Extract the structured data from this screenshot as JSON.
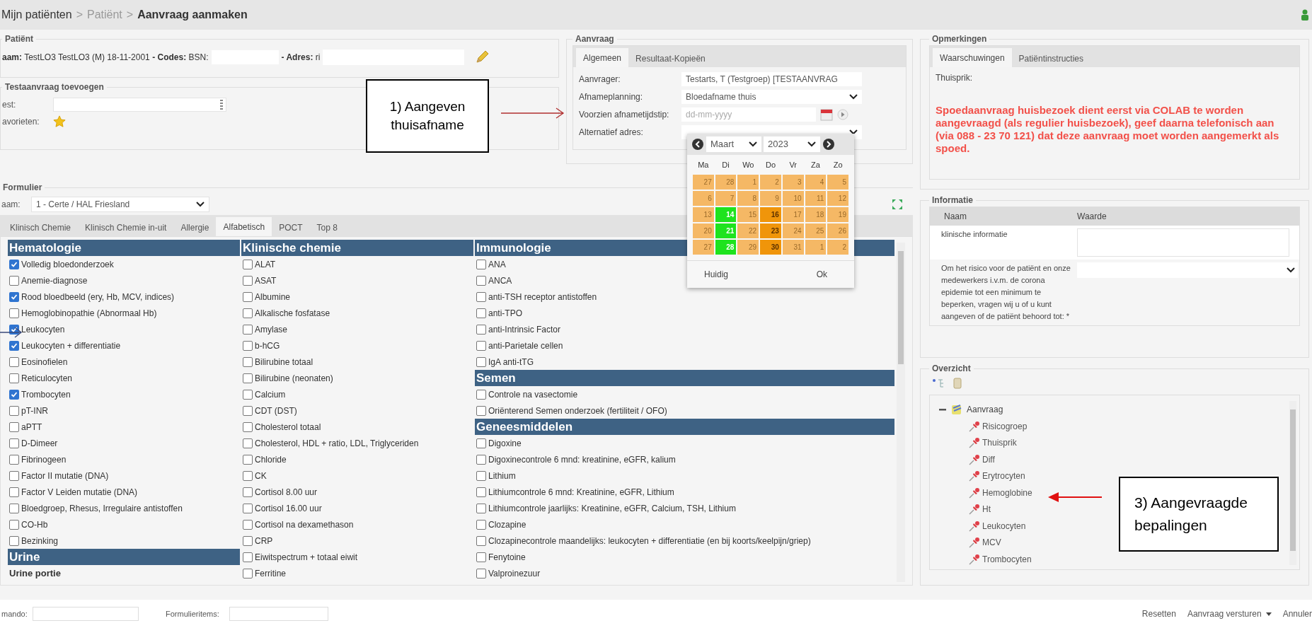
{
  "breadcrumb": {
    "separator": ">",
    "items": [
      {
        "label": "Mijn patiënten",
        "kind": "link"
      },
      {
        "label": "Patiënt",
        "kind": "disabled"
      },
      {
        "label": "Aanvraag aanmaken",
        "kind": "current"
      }
    ]
  },
  "patient": {
    "legend": "Patiënt",
    "name_label": "aam:",
    "name": "TestLO3 TestLO3 (M) 18-11-2001",
    "codes_label": "- Codes:",
    "bsn_label": "BSN:",
    "address_label": "- Adres:",
    "address": "ri"
  },
  "test_request": {
    "legend": "Testaanvraag toevoegen",
    "test_label": "est:",
    "favorites_label": "avorieten:"
  },
  "request": {
    "legend": "Aanvraag",
    "tabs": [
      {
        "label": "Algemeen",
        "selected": true
      },
      {
        "label": "Resultaat-Kopieën",
        "selected": false
      }
    ],
    "requester_label": "Aanvrager:",
    "requester": "Testarts, T (Testgroep) [TESTAANVRAG",
    "planning_label": "Afnameplanning:",
    "planning": "Bloedafname thuis",
    "time_label": "Voorzien afnametijdstip:",
    "time_placeholder": "dd-mm-yyyy",
    "address_label": "Alternatief adres:"
  },
  "calendar": {
    "month": "Maart",
    "year": "2023",
    "weekdays": [
      "Ma",
      "Di",
      "Wo",
      "Do",
      "Vr",
      "Za",
      "Zo"
    ],
    "days": [
      {
        "day": "27",
        "kind": "default"
      },
      {
        "day": "28",
        "kind": "default"
      },
      {
        "day": "1",
        "kind": "default"
      },
      {
        "day": "2",
        "kind": "default"
      },
      {
        "day": "3",
        "kind": "default"
      },
      {
        "day": "4",
        "kind": "default"
      },
      {
        "day": "5",
        "kind": "default"
      },
      {
        "day": "6",
        "kind": "default"
      },
      {
        "day": "7",
        "kind": "default"
      },
      {
        "day": "8",
        "kind": "default"
      },
      {
        "day": "9",
        "kind": "default"
      },
      {
        "day": "10",
        "kind": "default"
      },
      {
        "day": "11",
        "kind": "default"
      },
      {
        "day": "12",
        "kind": "default"
      },
      {
        "day": "13",
        "kind": "default"
      },
      {
        "day": "14",
        "kind": "available"
      },
      {
        "day": "15",
        "kind": "default"
      },
      {
        "day": "16",
        "kind": "planned"
      },
      {
        "day": "17",
        "kind": "default"
      },
      {
        "day": "18",
        "kind": "default"
      },
      {
        "day": "19",
        "kind": "default"
      },
      {
        "day": "20",
        "kind": "default"
      },
      {
        "day": "21",
        "kind": "available"
      },
      {
        "day": "22",
        "kind": "default"
      },
      {
        "day": "23",
        "kind": "planned"
      },
      {
        "day": "24",
        "kind": "default"
      },
      {
        "day": "25",
        "kind": "default"
      },
      {
        "day": "26",
        "kind": "default"
      },
      {
        "day": "27",
        "kind": "default"
      },
      {
        "day": "28",
        "kind": "available"
      },
      {
        "day": "29",
        "kind": "default"
      },
      {
        "day": "30",
        "kind": "planned"
      },
      {
        "day": "31",
        "kind": "default"
      },
      {
        "day": "1",
        "kind": "default"
      },
      {
        "day": "2",
        "kind": "default"
      }
    ],
    "today_button": "Huidig",
    "ok_button": "Ok"
  },
  "form": {
    "legend": "Formulier",
    "name_label": "aam:",
    "name": "1 - Certe / HAL Friesland",
    "tabs": [
      {
        "label": "Klinisch Chemie",
        "selected": false
      },
      {
        "label": "Klinisch Chemie in-uit",
        "selected": false
      },
      {
        "label": "Allergie",
        "selected": false
      },
      {
        "label": "Alfabetisch",
        "selected": true
      },
      {
        "label": "POCT",
        "selected": false
      },
      {
        "label": "Top 8",
        "selected": false
      }
    ],
    "columns": [
      {
        "sections": [
          {
            "title": "Hematologie",
            "items": [
              {
                "label": "Volledig bloedonderzoek",
                "checked": true
              },
              {
                "label": "Anemie-diagnose",
                "checked": false
              },
              {
                "label": "Rood bloedbeeld (ery, Hb, MCV, indices)",
                "checked": true
              },
              {
                "label": "Hemoglobinopathie (Abnormaal Hb)",
                "checked": false
              },
              {
                "label": "Leukocyten",
                "checked": true
              },
              {
                "label": "Leukocyten + differentiatie",
                "checked": true
              },
              {
                "label": "Eosinofielen",
                "checked": false
              },
              {
                "label": "Reticulocyten",
                "checked": false
              },
              {
                "label": "Trombocyten",
                "checked": true
              },
              {
                "label": "pT-INR",
                "checked": false
              },
              {
                "label": "aPTT",
                "checked": false
              },
              {
                "label": "D-Dimeer",
                "checked": false
              },
              {
                "label": "Fibrinogeen",
                "checked": false
              },
              {
                "label": "Factor II mutatie (DNA)",
                "checked": false
              },
              {
                "label": "Factor V Leiden mutatie (DNA)",
                "checked": false
              },
              {
                "label": "Bloedgroep, Rhesus, Irregulaire antistoffen",
                "checked": false
              },
              {
                "label": "CO-Hb",
                "checked": false
              },
              {
                "label": "Bezinking",
                "checked": false
              }
            ]
          },
          {
            "title": "Urine",
            "subtitle": "Urine portie"
          }
        ]
      },
      {
        "sections": [
          {
            "title": "Klinische chemie",
            "items": [
              {
                "label": "ALAT",
                "checked": false
              },
              {
                "label": "ASAT",
                "checked": false
              },
              {
                "label": "Albumine",
                "checked": false
              },
              {
                "label": "Alkalische fosfatase",
                "checked": false
              },
              {
                "label": "Amylase",
                "checked": false
              },
              {
                "label": "b-hCG",
                "checked": false
              },
              {
                "label": "Bilirubine totaal",
                "checked": false
              },
              {
                "label": "Bilirubine (neonaten)",
                "checked": false
              },
              {
                "label": "Calcium",
                "checked": false
              },
              {
                "label": "CDT (DST)",
                "checked": false
              },
              {
                "label": "Cholesterol totaal",
                "checked": false
              },
              {
                "label": "Cholesterol, HDL + ratio, LDL, Triglyceriden",
                "checked": false
              },
              {
                "label": "Chloride",
                "checked": false
              },
              {
                "label": "CK",
                "checked": false
              },
              {
                "label": "Cortisol 8.00 uur",
                "checked": false
              },
              {
                "label": "Cortisol 16.00 uur",
                "checked": false
              },
              {
                "label": "Cortisol na dexamethason",
                "checked": false
              },
              {
                "label": "CRP",
                "checked": false
              },
              {
                "label": "Eiwitspectrum + totaal eiwit",
                "checked": false
              },
              {
                "label": "Ferritine",
                "checked": false
              }
            ]
          }
        ]
      },
      {
        "sections": [
          {
            "title": "Immunologie",
            "items": [
              {
                "label": "ANA",
                "checked": false
              },
              {
                "label": "ANCA",
                "checked": false
              },
              {
                "label": "anti-TSH receptor antistoffen",
                "checked": false
              },
              {
                "label": "anti-TPO",
                "checked": false
              },
              {
                "label": "anti-Intrinsic Factor",
                "checked": false
              },
              {
                "label": "anti-Parietale cellen",
                "checked": false
              },
              {
                "label": "IgA anti-tTG",
                "checked": false
              }
            ]
          },
          {
            "title": "Semen",
            "items": [
              {
                "label": "Controle na vasectomie",
                "checked": false
              },
              {
                "label": "Oriënterend Semen onderzoek (fertiliteit / OFO)",
                "checked": false
              }
            ]
          },
          {
            "title": "Geneesmiddelen",
            "items": [
              {
                "label": "Digoxine",
                "checked": false
              },
              {
                "label": "Digoxinecontrole 6 mnd: kreatinine, eGFR, kalium",
                "checked": false
              },
              {
                "label": "Lithium",
                "checked": false
              },
              {
                "label": "Lithiumcontrole 6 mnd: Kreatinine, eGFR, Lithium",
                "checked": false
              },
              {
                "label": "Lithiumcontrole jaarlijks: Kreatinine, eGFR, Calcium, TSH, Lithium",
                "checked": false
              },
              {
                "label": "Clozapine",
                "checked": false
              },
              {
                "label": "Clozapinecontrole maandelijks: leukocyten + differentiatie (en bij koorts/keelpijn/griep)",
                "checked": false
              },
              {
                "label": "Fenytoine",
                "checked": false
              },
              {
                "label": "Valproinezuur",
                "checked": false
              }
            ]
          }
        ]
      }
    ]
  },
  "remarks": {
    "legend": "Opmerkingen",
    "tabs": [
      {
        "label": "Waarschuwingen",
        "selected": true
      },
      {
        "label": "Patiëntinstructies",
        "selected": false
      }
    ],
    "heading": "Thuisprik:",
    "warning": "Spoedaanvraag huisbezoek dient eerst via COLAB te worden aangevraagd (als regulier huisbezoek), geef daarna telefonisch aan (via 088 - 23 70 121) dat deze aanvraag moet worden aangemerkt als spoed."
  },
  "information": {
    "legend": "Informatie",
    "columns": [
      "Naam",
      "Waarde"
    ],
    "rows": [
      {
        "name": "klinische informatie",
        "kind": "textarea"
      },
      {
        "name": "Om het risico voor de patiënt en onze medewerkers i.v.m. de corona epidemie tot een minimum te beperken, vragen wij u of u kunt aangeven of de patiënt behoord tot: *",
        "kind": "select"
      }
    ]
  },
  "overview": {
    "legend": "Overzicht",
    "tree": {
      "label": "Aanvraag",
      "expanded": true,
      "children": [
        {
          "label": "Risicogroep"
        },
        {
          "label": "Thuisprik"
        },
        {
          "label": "Diff"
        },
        {
          "label": "Erytrocyten"
        },
        {
          "label": "Hemoglobine"
        },
        {
          "label": "Ht"
        },
        {
          "label": "Leukocyten"
        },
        {
          "label": "MCV"
        },
        {
          "label": "Trombocyten"
        }
      ]
    }
  },
  "footer": {
    "command_label": "mando:",
    "form_items_label": "Formulieritems:",
    "buttons": [
      {
        "label": "Resetten",
        "dropdown": false
      },
      {
        "label": "Aanvraag versturen",
        "dropdown": true
      },
      {
        "label": "Annuler",
        "dropdown": false
      }
    ]
  },
  "callouts": [
    {
      "text": "1) Aangeven thuisafname",
      "kind": "top"
    },
    {
      "text": "3) Aangevraagde bepalingen",
      "kind": "bottom"
    }
  ]
}
